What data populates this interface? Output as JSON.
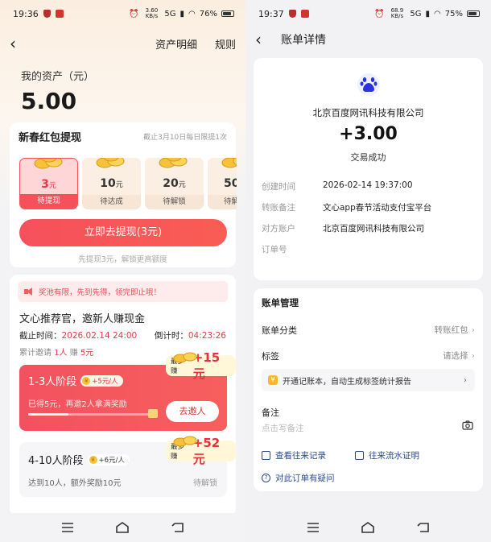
{
  "left": {
    "status": {
      "time": "19:36",
      "net": "3.60 KB/s",
      "sig": "5G",
      "battery": "76%"
    },
    "header": {
      "links": [
        "资产明细",
        "规则"
      ]
    },
    "asset": {
      "label": "我的资产（元）",
      "value": "5.00"
    },
    "hongbao": {
      "title": "新春红包提现",
      "note": "截止3月10日每日限提1次",
      "tiles": [
        {
          "amount": "3",
          "unit": "元",
          "status": "待提现",
          "active": true
        },
        {
          "amount": "10",
          "unit": "元",
          "status": "待达成",
          "active": false
        },
        {
          "amount": "20",
          "unit": "元",
          "status": "待解锁",
          "active": false
        },
        {
          "amount": "50",
          "unit": "",
          "status": "待解",
          "active": false
        }
      ],
      "button": "立即去提现(3元)",
      "hint": "先提现3元，解锁更高额度"
    },
    "invite": {
      "notice": "奖池有限，先到先得，领完即止哦！",
      "title": "文心推荐官，邀新人赚现金",
      "deadline_label": "截止时间：",
      "deadline": "2026.02.14 24:00",
      "countdown_label": "倒计时：",
      "countdown": "04:23:26",
      "count_prefix": "累计邀请",
      "count_invited": "1人",
      "count_mid": "赚",
      "count_earned": "5元",
      "stage1": {
        "title": "1-3人阶段",
        "rate": "+5元/人",
        "most_label": "最多赚",
        "most_value": "+15元",
        "desc": "已得5元，再邀2人拿满奖励",
        "progress": 0.33,
        "button": "去邀人"
      },
      "stage2": {
        "title": "4-10人阶段",
        "rate": "+6元/人",
        "most_label": "最多赚",
        "most_value": "+52元",
        "desc": "达到10人，额外奖励10元",
        "status": "待解锁"
      }
    }
  },
  "right": {
    "status": {
      "time": "19:37",
      "net": "68.9 KB/s",
      "sig": "5G",
      "battery": "75%"
    },
    "header": {
      "title": "账单详情"
    },
    "bill": {
      "company": "北京百度网讯科技有限公司",
      "amount": "+3.00",
      "status": "交易成功",
      "rows": [
        {
          "k": "创建时间",
          "v": "2026-02-14 19:37:00"
        },
        {
          "k": "转账备注",
          "v": "文心app春节活动支付宝平台"
        },
        {
          "k": "对方账户",
          "v": "北京百度网讯科技有限公司"
        },
        {
          "k": "订单号",
          "v": ""
        }
      ]
    },
    "mgmt": {
      "title": "账单管理",
      "category_label": "账单分类",
      "category_value": "转账红包",
      "tag_label": "标签",
      "tag_value": "请选择",
      "tip": "开通记账本，自动生成标签统计报告",
      "note_label": "备注",
      "note_placeholder": "点击写备注",
      "link1": "查看往来记录",
      "link2": "往来流水证明",
      "question": "对此订单有疑问"
    }
  },
  "colors": {
    "accent": "#f4515a",
    "link": "#2b4a8c",
    "gold": "#f7c23b"
  }
}
